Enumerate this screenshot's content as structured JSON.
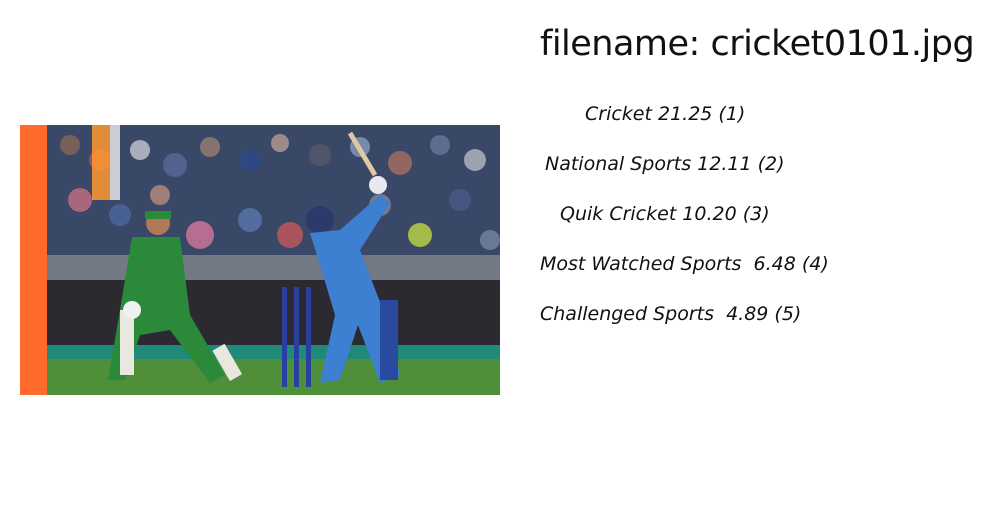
{
  "filename_label": "filename: cricket0101.jpg",
  "predictions": [
    {
      "text": "Cricket 21.25 (1)"
    },
    {
      "text": "National Sports 12.11 (2)"
    },
    {
      "text": "Quik Cricket 10.20 (3)"
    },
    {
      "text": "Most Watched Sports  6.48 (4)"
    },
    {
      "text": "Challenged Sports  4.89 (5)"
    }
  ],
  "image": {
    "icon": "cricket-photo",
    "colors": {
      "left_bar": "#ff6a2b",
      "crowd": "#3a4a6a",
      "pitch": "#4f8f3a",
      "keeper_kit": "#2a8a3a",
      "batsman_kit": "#3d7fd0",
      "stumps": "#2a3fa0"
    }
  }
}
